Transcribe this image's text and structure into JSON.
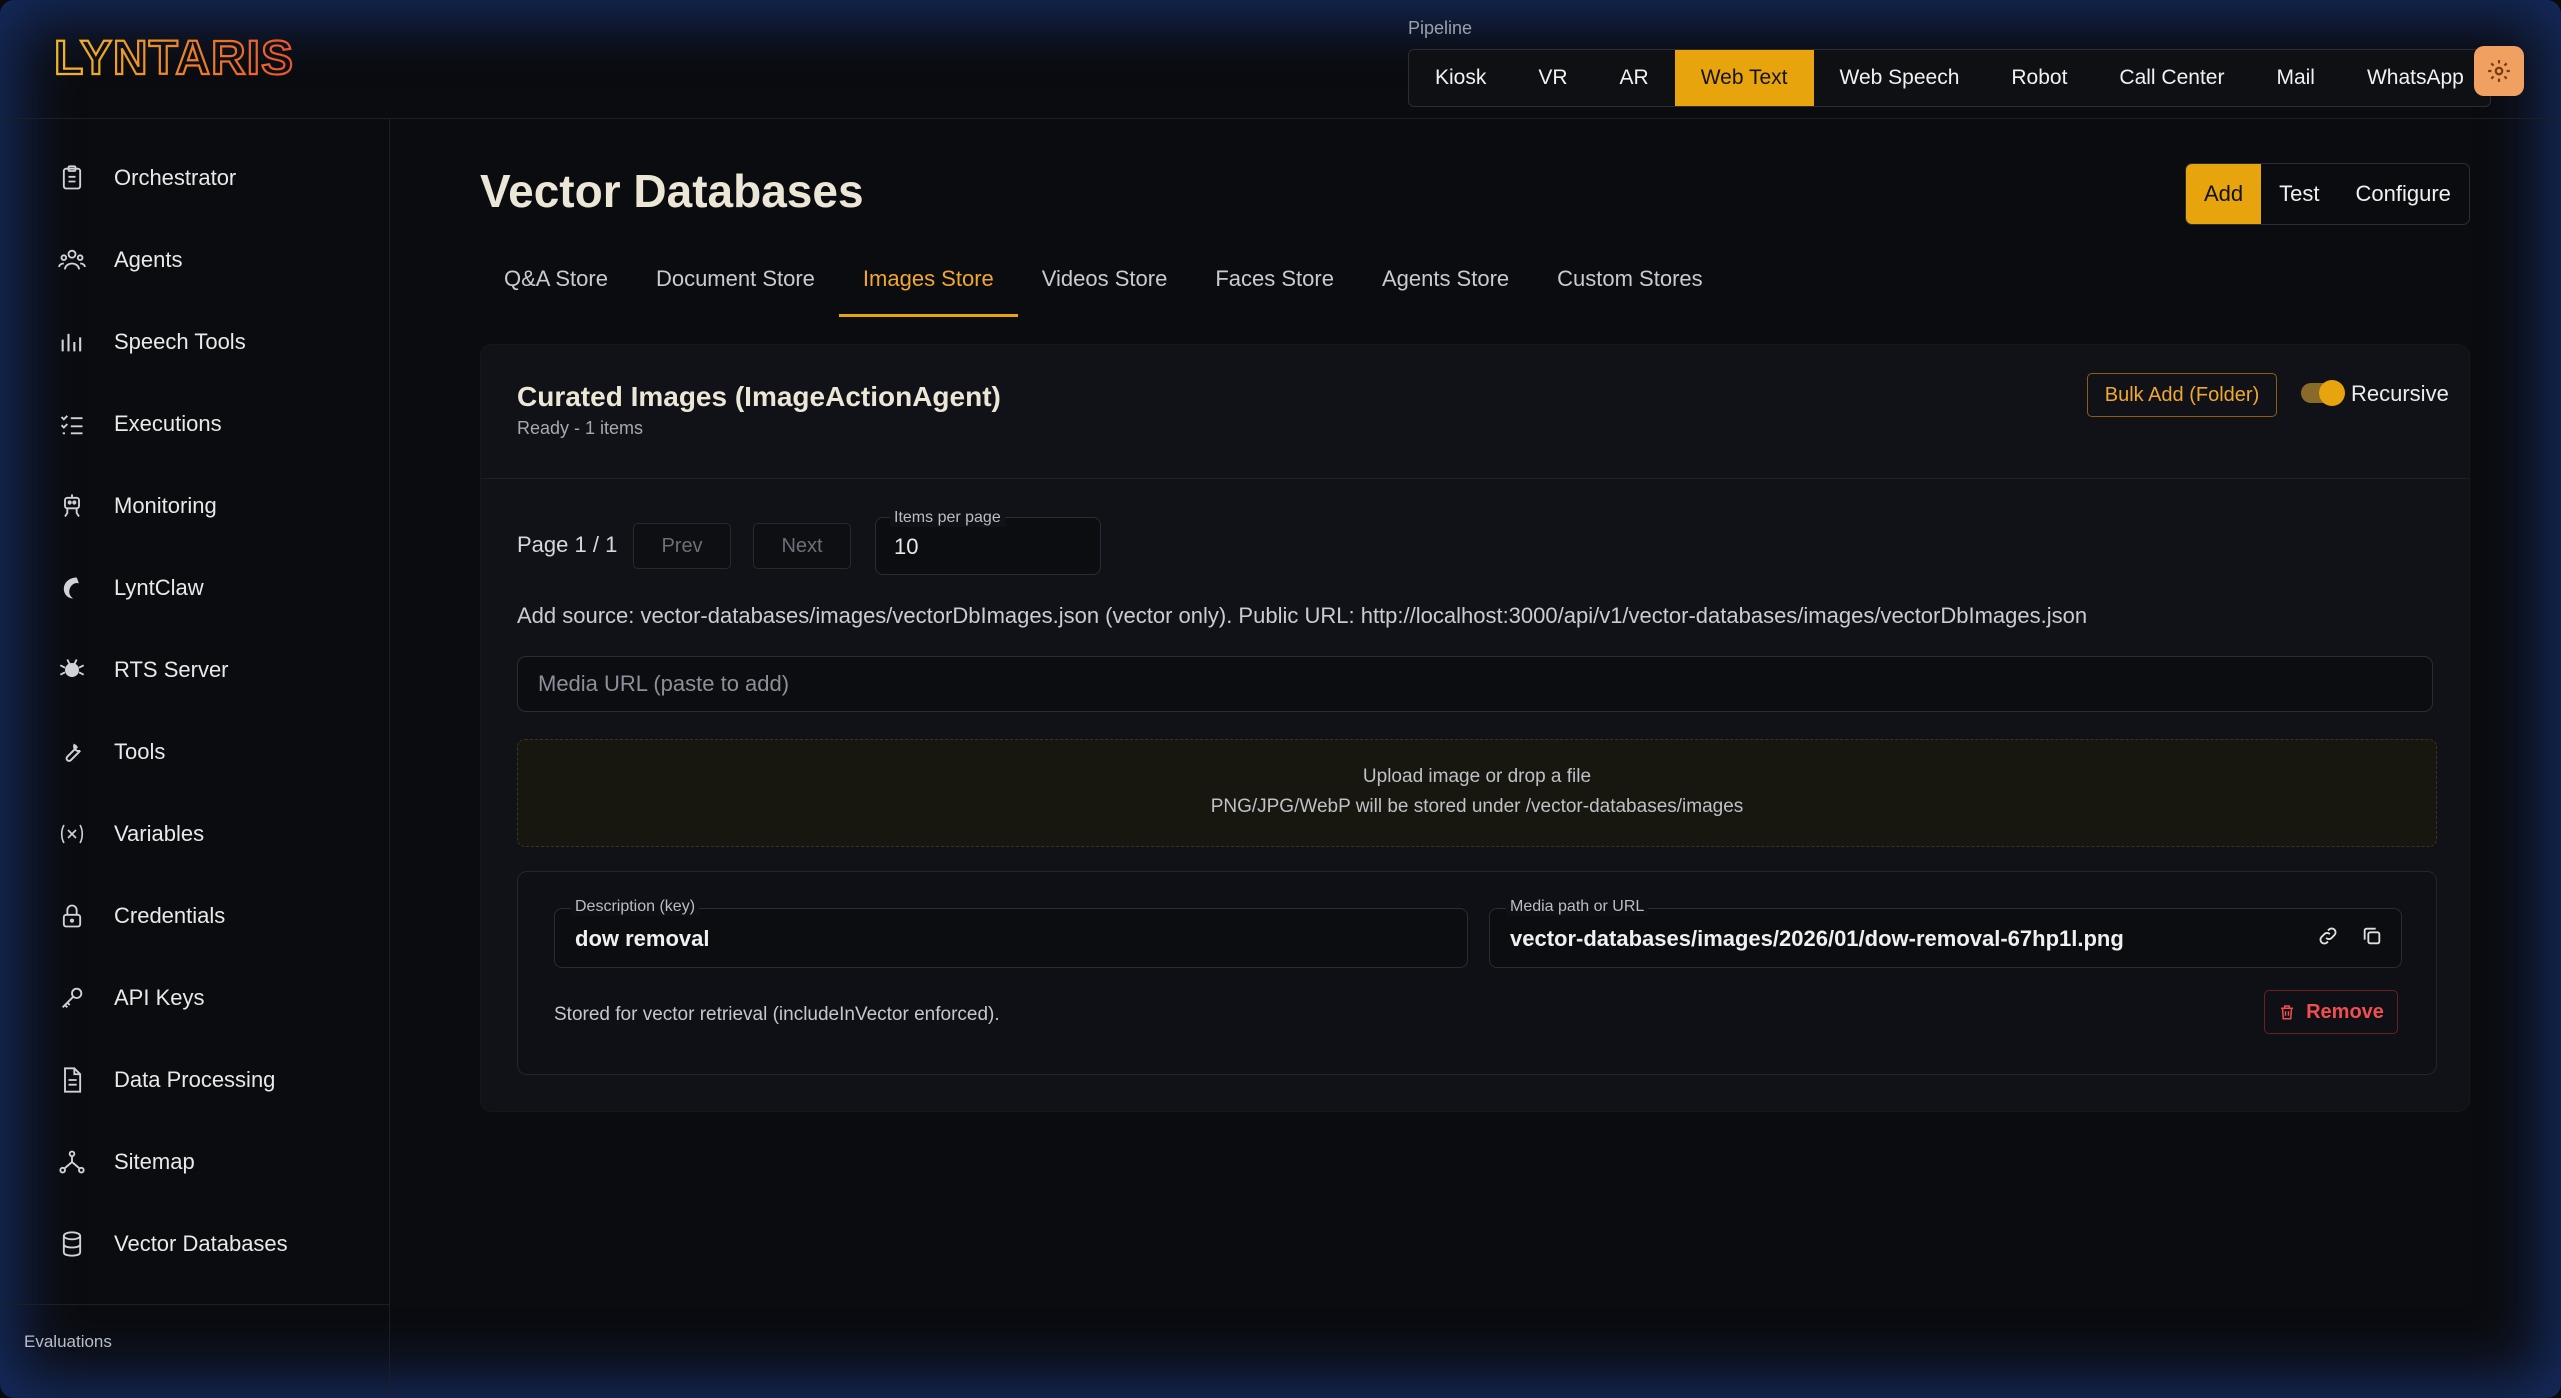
{
  "brand": {
    "logo_text": "LYNTARIS"
  },
  "pipeline": {
    "label": "Pipeline",
    "tabs": [
      "Kiosk",
      "VR",
      "AR",
      "Web Text",
      "Web Speech",
      "Robot",
      "Call Center",
      "Mail",
      "WhatsApp"
    ],
    "active": "Web Text"
  },
  "sidebar": {
    "items": [
      {
        "label": "Orchestrator",
        "icon": "clipboard-icon"
      },
      {
        "label": "Agents",
        "icon": "users-icon"
      },
      {
        "label": "Speech Tools",
        "icon": "bar-chart-icon"
      },
      {
        "label": "Executions",
        "icon": "list-check-icon"
      },
      {
        "label": "Monitoring",
        "icon": "robot-icon"
      },
      {
        "label": "LyntClaw",
        "icon": "claw-icon"
      },
      {
        "label": "RTS Server",
        "icon": "server-icon"
      },
      {
        "label": "Tools",
        "icon": "wrench-icon"
      },
      {
        "label": "Variables",
        "icon": "variable-icon"
      },
      {
        "label": "Credentials",
        "icon": "lock-icon"
      },
      {
        "label": "API Keys",
        "icon": "key-icon"
      },
      {
        "label": "Data Processing",
        "icon": "document-icon"
      },
      {
        "label": "Sitemap",
        "icon": "sitemap-icon"
      },
      {
        "label": "Vector Databases",
        "icon": "database-icon"
      }
    ],
    "section_label": "Evaluations"
  },
  "page": {
    "title": "Vector Databases",
    "actions": [
      "Add",
      "Test",
      "Configure"
    ],
    "store_tabs": [
      "Q&A Store",
      "Document Store",
      "Images Store",
      "Videos Store",
      "Faces Store",
      "Agents Store",
      "Custom Stores"
    ],
    "active_tab": "Images Store"
  },
  "card": {
    "title": "Curated Images (ImageActionAgent)",
    "subtitle": "Ready - 1 items",
    "bulk_button": "Bulk Add (Folder)",
    "toggle_label": "Recursive",
    "toggle_on": true,
    "pager": {
      "text": "Page 1 / 1",
      "prev": "Prev",
      "next": "Next",
      "ipp_label": "Items per page",
      "ipp_value": "10"
    },
    "add_source": "Add source: vector-databases/images/vectorDbImages.json (vector only). Public URL: http://localhost:3000/api/v1/vector-databases/images/vectorDbImages.json",
    "media_placeholder": "Media URL (paste to add)",
    "dropzone": {
      "line1": "Upload image or drop a file",
      "line2": "PNG/JPG/WebP will be stored under /vector-databases/images"
    },
    "item": {
      "desc_label": "Description (key)",
      "desc_value": "dow removal",
      "path_label": "Media path or URL",
      "path_value": "vector-databases/images/2026/01/dow-removal-67hp1l.png",
      "note": "Stored for vector retrieval (includeInVector enforced).",
      "remove_label": "Remove"
    }
  },
  "colors": {
    "accent": "#e8a40c",
    "danger": "#ef4f4f",
    "background": "#0b0c10"
  }
}
